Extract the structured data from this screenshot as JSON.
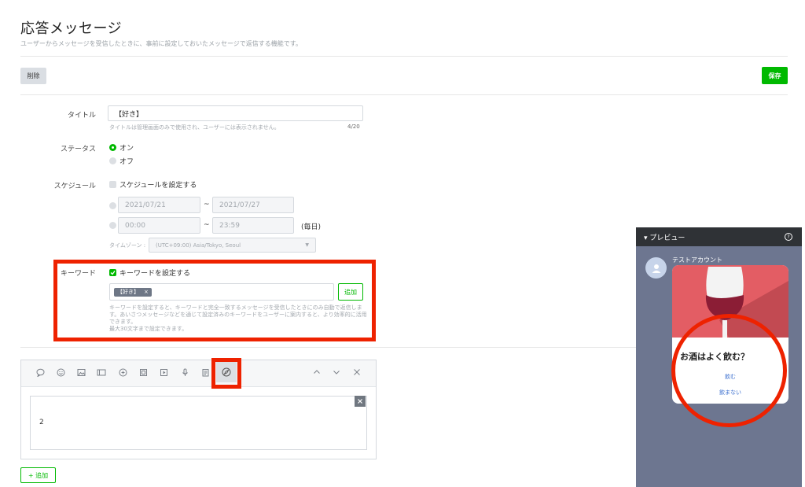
{
  "header": {
    "title": "応答メッセージ",
    "description": "ユーザーからメッセージを受信したときに、事前に設定しておいたメッセージで返信する機能です。"
  },
  "actions": {
    "delete_label": "削除",
    "save_label": "保存"
  },
  "form": {
    "title_label": "タイトル",
    "title_value": "【好き】",
    "title_hint": "タイトルは管理画面のみで使用され、ユーザーには表示されません。",
    "title_count": "4/20",
    "status_label": "ステータス",
    "status_on": "オン",
    "status_off": "オフ",
    "schedule_label": "スケジュール",
    "schedule_checkbox": "スケジュールを設定する",
    "date_start": "2021/07/21",
    "date_end": "2021/07/27",
    "time_start": "00:00",
    "time_end": "23:59",
    "tilde": "~",
    "daily": "(毎日)",
    "timezone_label": "タイムゾーン :",
    "timezone_value": "(UTC+09:00) Asia/Tokyo, Seoul",
    "keyword_label": "キーワード",
    "keyword_checkbox": "キーワードを設定する",
    "keyword_tag": "【好き】",
    "keyword_tag_close": "×",
    "keyword_add": "追加",
    "keyword_hint_1": "キーワードを設定すると、キーワードと完全一致するメッセージを受信したときにのみ自動で返信しま",
    "keyword_hint_2": "す。あいさつメッセージなどを通じて設定済みのキーワードをユーザーに案内すると、より効率的に活用",
    "keyword_hint_3": "できます。",
    "keyword_hint_4": "最大30文字まで設定できます。"
  },
  "editor": {
    "icons": [
      "speech-bubble-icon",
      "emoji-icon",
      "image-icon",
      "card-icon",
      "coupon-icon",
      "video-icon",
      "play-icon",
      "mic-icon",
      "survey-icon",
      "compass-icon"
    ],
    "content": "2",
    "add_label": "+ 追加"
  },
  "preview": {
    "header": "▾ プレビュー",
    "help": "?",
    "account_name": "テストアカウント",
    "card_title": "お酒はよく飲む？",
    "option_1": "飲む",
    "option_2": "飲まない"
  },
  "colors": {
    "accent": "#00b900",
    "highlight": "#ee2200",
    "preview_bg": "#6d7690",
    "preview_header": "#2f3236"
  }
}
